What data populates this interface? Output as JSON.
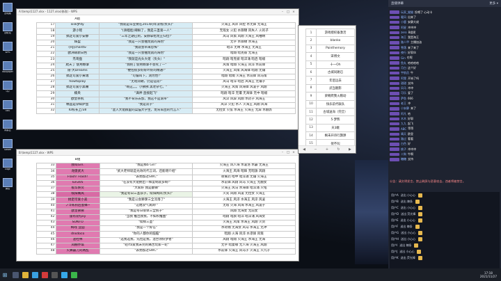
{
  "sheetA": {
    "title": "A:\\temp\\1127.xlsx - 1127.xlsx(修改) - WPS",
    "header": "A组",
    "rows": [
      {
        "n": "17",
        "name": "sisk梦dy",
        "quote": "\"我就是毕业要在2014的年没钱(负头)\"",
        "members": "火海王 风岸 风拉 水无锋 无海王"
      },
      {
        "n": "18",
        "name": "游小瑶",
        "quote": "\"(滑稽脸)辣鲜了，我是三圣第一人\"",
        "members": "无瑕女 火犯 水御锦 风失人 火的子"
      },
      {
        "n": "19",
        "name": "搞定可爱小安静",
        "quote": "\"三年之期已到，安静拿给龙王归位!\"",
        "members": "风马 风策 风翔 火海王 风袖晴"
      },
      {
        "n": "20",
        "name": "辉盈",
        "quote": "\"我是一只会抽龙就的海豹\"",
        "members": "无字 水御锦 水海王"
      },
      {
        "n": "21",
        "name": "-[RJ]chardS-",
        "quote": "\"我就会带来恐怖\"",
        "members": "暗淬 无晴 水海王 无海王"
      },
      {
        "n": "22",
        "name": "欧洲萌新白色",
        "quote": "\"我是一只会抽龙就的海豹\"",
        "members": "暗翔 暗克彼 无海王"
      },
      {
        "n": "23",
        "name": "杰哥盘",
        "quote": "\"我就是光头大佬（负头）\"",
        "members": "暗翔 暗克彼 暗淬涌 暗启 暗缀"
      },
      {
        "n": "24",
        "name": "爬天丁 使用颗掌",
        "quote": "\"我把丁使用颗掌不会死了—\"",
        "members": "风策 暗翔 火海王 风淬 水前锋"
      },
      {
        "n": "25",
        "name": "隐-大Dreams",
        "quote": "\"梗控很多好好坏好的精通!\"",
        "members": "火海王 风策 风海锋 暗翔 无镶"
      },
      {
        "n": "26",
        "name": "搞定可爱小黄瑞",
        "quote": "\"可偏叫下，测为怡!\"",
        "members": "暗翔 暗缀 火海王 水前锋 风马策"
      },
      {
        "n": "27",
        "name": "howtoplay",
        "quote": "\"无暗润朝，仍是征段!\"",
        "members": "风马 暗淬 暗启 风海王 无镶子"
      },
      {
        "n": "28",
        "name": "搞定可爱小黑嘴",
        "quote": "\"啊这。。。小拂拂 黑老杂七。\"",
        "members": "火海王 风策 风海锋 风凌子 风翔"
      },
      {
        "n": "29",
        "name": "楠央",
        "quote": "\"满神 直接起飞\"",
        "members": "暗翔 暗淬 无镶 无海锋 无中 暗缀"
      },
      {
        "n": "30",
        "name": "欧皇杀机",
        "quote": "\"我不背乐去加，我这不是滚带\"",
        "members": "风淬 风异 风翔 水药子 风海王"
      },
      {
        "n": "31",
        "name": "精品是杂碎萨鱼",
        "quote": "\"我是双子\"",
        "members": "风淬 火犯 水人 火海王 风翔 风海"
      },
      {
        "n": "32",
        "name": "IU校长上/3Ⅱ",
        "quote": "\"混入大佬群里的菜猫大学生，龙背军团的代言人\"",
        "members": "无拉女 火弦 水海王 火海王 无异 水翻苏"
      }
    ]
  },
  "sheetB": {
    "title": "B:\\temp\\1127.xlsx - WPS",
    "header": "B组",
    "rows": [
      {
        "n": "33",
        "name": "我叫Gin.",
        "quote": "\"我是那b Gin\"",
        "members": "火海王 风人海 水凌洛 水霸 无海王"
      },
      {
        "n": "34",
        "name": "龙傲武大",
        "quote": "\"武大老师就是光效的代言词，还能增介绍\"",
        "members": "火海王 风海 暗辉 无暗旗 风翔"
      },
      {
        "n": "35",
        "name": "Flash! Flash!",
        "quote": "\"表扬加过SWC\"",
        "members": "喷雾药 暗中 暗淬涌 无镶 火海王"
      },
      {
        "n": "36",
        "name": "lun305",
        "quote": "\"在没有大佬拥出一样度制就多啊!\"",
        "members": "水前锋 风翔 风马 火海王 无翻女"
      },
      {
        "n": "37",
        "name": "板华焕荧",
        "quote": "\"大家好 我是翻镇\"",
        "members": "火海王 风马 水海锋 暗淬涌 火龟"
      },
      {
        "n": "38",
        "name": "续阳阁风",
        "quote": "\"我是冬日三圣孩子，续阳阁风(负头)\"",
        "members": "火光 风翔 风凌 无拉女 火海王"
      },
      {
        "n": "39",
        "name": "搞定可爱小美",
        "quote": "\"我是公会狮掌三全流落了\"",
        "members": "火海王 风淬 水海王 风淬 风凌"
      },
      {
        "n": "40",
        "name": "フゴ练狗后蜜蜂~",
        "quote": "\"这她没气滴滴!\"",
        "members": "无瑕 火海 风海 水海王 风凌子"
      },
      {
        "n": "41",
        "name": "欧皇拂拂",
        "quote": "\"我是冬日很单三全统子\"",
        "members": "风翔 无海女 无前女"
      },
      {
        "n": "42",
        "name": "雷有装fyxy",
        "quote": "\"当我 推出我我，不如积推图\"",
        "members": "暗翔 暗旗 暗淬 暗淬涌 风海女"
      },
      {
        "n": "43",
        "name": "SUNTO",
        "quote": "\"续样三圣\"",
        "members": "火海王 风策 水海王 风翔 火剑"
      },
      {
        "n": "44",
        "name": "梅戏 亚园",
        "quote": "\"我是一个好信\"",
        "members": "水荷锦 无海女 风马 水海王 无冲"
      },
      {
        "n": "45",
        "name": "dnsdoco",
        "quote": "\"你的人都你的脑脑\"",
        "members": "暗翔 火海 风淬 水凛锋 风策"
      },
      {
        "n": "46",
        "name": "混杜林",
        "quote": "\"选我选我，先拉是我，混合领好梦者\"",
        "members": "风翔 暗翔 火海王 水海王 无海"
      },
      {
        "n": "47",
        "name": "风棚乔琪",
        "quote": "\"轻rta爱我未完的痛苦玩家一轮\"",
        "members": "无字 暗复嘟 无人海 火海王 风翔"
      },
      {
        "n": "48",
        "name": "火舞霸刀刘两乱",
        "quote": "\"表扬加过SWC\"",
        "members": "水前锋 火海王 风马子 火海王 火凡子"
      }
    ]
  },
  "listWin": {
    "rows": [
      {
        "n": "1",
        "v": "游戏授权备激活"
      },
      {
        "n": "2",
        "v": "blanko"
      },
      {
        "n": "3",
        "v": "Painthemory"
      },
      {
        "n": "4",
        "v": "宋博文"
      },
      {
        "n": "5",
        "v": "十一Oh"
      },
      {
        "n": "6",
        "v": "古城同路已"
      },
      {
        "n": "7",
        "v": "年后远去"
      },
      {
        "n": "8",
        "v": "武当魅影"
      },
      {
        "n": "9",
        "v": "梁朝爬我火粮动"
      },
      {
        "n": "10",
        "v": "快乐前代联队"
      },
      {
        "n": "11",
        "v": "古城送海（完全）"
      },
      {
        "n": "12",
        "v": "5·梦熊"
      },
      {
        "n": "13",
        "v": "天3蛾"
      },
      {
        "n": "14",
        "v": "枫未开诗行飘渺"
      },
      {
        "n": "15",
        "v": "荷不叫"
      },
      {
        "n": "16",
        "v": "梅梅炮辣鲜"
      },
      {
        "n": "17",
        "v": "东莱"
      }
    ]
  },
  "chat": {
    "header_left": "直播弹幕",
    "header_right": "更多 ▾",
    "messages": [
      {
        "user": "玩家_猫猫",
        "text": "投喂了 心动卡",
        "gift": true
      },
      {
        "user": "暖风",
        "text": "出来了"
      },
      {
        "user": "小鹿",
        "text": "安静大佬"
      },
      {
        "user": "阿星",
        "text": "冲冲冲"
      },
      {
        "user": "zero",
        "text": "B组呢"
      },
      {
        "user": "海王",
        "text": "我是海王"
      },
      {
        "user": "路人甲",
        "text": "主播加油",
        "gift": true
      },
      {
        "user": "雪落",
        "text": "来了来了"
      },
      {
        "user": "夜行",
        "text": "好家伙"
      },
      {
        "user": "Gin",
        "text": "在呢"
      },
      {
        "user": "鱼丸",
        "text": "哈哈哈哈"
      },
      {
        "user": "月白",
        "text": "这个好"
      },
      {
        "user": "宇航员",
        "text": "牛"
      },
      {
        "user": "阿狸",
        "text": "开始了吗"
      },
      {
        "user": "甜甜",
        "text": "支持"
      },
      {
        "user": "风马",
        "text": "冲冲"
      },
      {
        "user": "可乐",
        "text": "爱了"
      },
      {
        "user": "萨鱼",
        "text": "666"
      },
      {
        "user": "老王",
        "text": "冲"
      },
      {
        "user": "小安静",
        "text": "来了"
      },
      {
        "user": "阿凡",
        "text": "哈"
      },
      {
        "user": "木木",
        "text": "好耶"
      },
      {
        "user": "九九",
        "text": "起飞"
      },
      {
        "user": "ABC",
        "text": "等等"
      },
      {
        "user": "晴天",
        "text": "欧皇"
      },
      {
        "user": "路过",
        "text": "看看"
      },
      {
        "user": "白色",
        "text": "好"
      },
      {
        "user": "桃子",
        "text": "冲冲冲"
      },
      {
        "user": "二狗",
        "text": "牛啊"
      },
      {
        "user": "糖糖",
        "text": "支持"
      }
    ],
    "system": "公告：请文明发言，禁止刷屏与恶意攻击，违者将被禁言。",
    "gifts": [
      {
        "user": "用户A",
        "text": "送出 小心心"
      },
      {
        "user": "用户B",
        "text": "送出 辣条"
      },
      {
        "user": "用户C",
        "text": "送出 小心心"
      },
      {
        "user": "用户D",
        "text": "送出 荧光棒"
      },
      {
        "user": "用户E",
        "text": "送出 小心心"
      },
      {
        "user": "用户F",
        "text": "送出 辣条"
      },
      {
        "user": "用户G",
        "text": "送出 小心心"
      },
      {
        "user": "用户H",
        "text": "送出 小心心"
      },
      {
        "user": "用户I",
        "text": "送出 辣条"
      },
      {
        "user": "用户J",
        "text": "送出 小心心"
      },
      {
        "user": "用户K",
        "text": "送出 荧光棒"
      }
    ]
  },
  "desktop_icons": [
    "此电脑",
    "回收站",
    "WPS",
    "Wallpaper",
    "QQ",
    "OBS",
    "网易云",
    "Steam",
    "Edge",
    "微信"
  ],
  "taskbar": {
    "time": "17:18",
    "date": "2021/11/27"
  },
  "colors": {
    "sheetA_fill": "#d7ecf5",
    "sheetB_fill": "#e07ab0",
    "chat_bg": "#1e2330"
  }
}
